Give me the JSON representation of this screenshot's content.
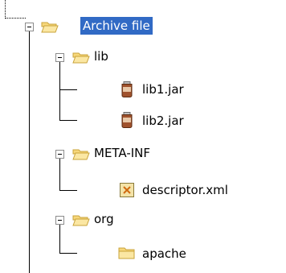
{
  "tree": {
    "root": {
      "label": "Archive file",
      "icon": "folder-open-icon",
      "selected": true
    },
    "lib": {
      "label": "lib",
      "icon": "folder-open-icon"
    },
    "lib1": {
      "label": "lib1.jar",
      "icon": "jar-icon"
    },
    "lib2": {
      "label": "lib2.jar",
      "icon": "jar-icon"
    },
    "meta": {
      "label": "META-INF",
      "icon": "folder-open-icon"
    },
    "descriptor": {
      "label": "descriptor.xml",
      "icon": "xml-file-icon"
    },
    "org": {
      "label": "org",
      "icon": "folder-open-icon"
    },
    "apache": {
      "label": "apache",
      "icon": "folder-closed-icon"
    }
  },
  "colors": {
    "selection": "#316ac5",
    "folder": "#f7d77b",
    "folder_border": "#c9a33a",
    "jar": "#a0522d"
  }
}
